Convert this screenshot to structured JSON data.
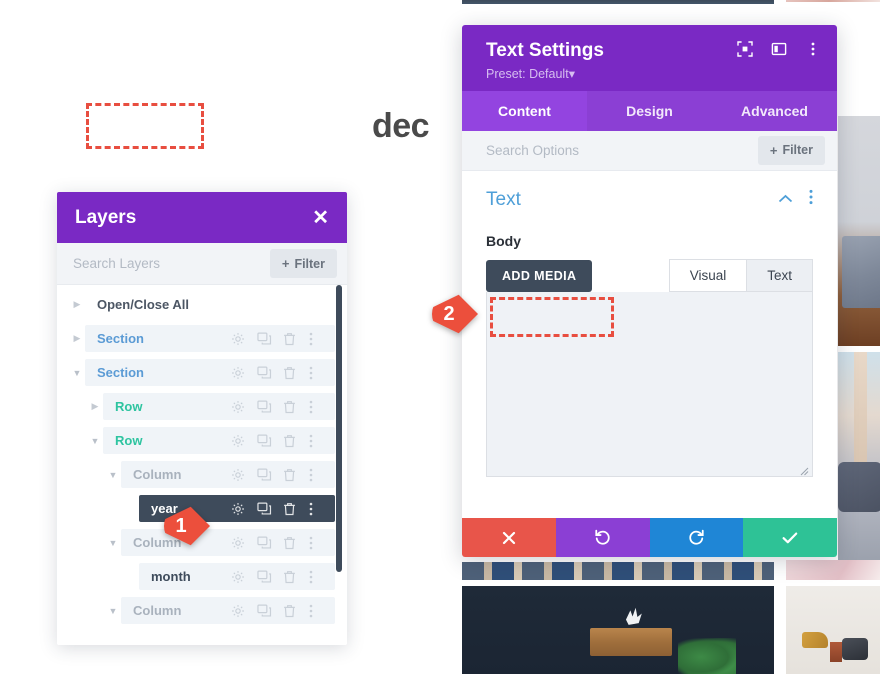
{
  "canvas": {
    "word": "dec",
    "placeholder_name": "empty-text-module"
  },
  "layers_panel": {
    "title": "Layers",
    "close_label": "✕",
    "search_placeholder": "Search Layers",
    "filter_label": "Filter",
    "filter_plus": "+",
    "rows": [
      {
        "label": "Open/Close All",
        "type": "open-close-all",
        "indent": 0,
        "triangle": "right",
        "chip": false,
        "icons": false,
        "active": false
      },
      {
        "label": "Section",
        "type": "section",
        "indent": 0,
        "triangle": "right",
        "chip": true,
        "icons": true,
        "active": false
      },
      {
        "label": "Section",
        "type": "section",
        "indent": 0,
        "triangle": "down",
        "chip": true,
        "icons": true,
        "active": false
      },
      {
        "label": "Row",
        "type": "row",
        "indent": 1,
        "triangle": "right",
        "chip": true,
        "icons": true,
        "active": false
      },
      {
        "label": "Row",
        "type": "row",
        "indent": 1,
        "triangle": "down",
        "chip": true,
        "icons": true,
        "active": false
      },
      {
        "label": "Column",
        "type": "column",
        "indent": 2,
        "triangle": "down",
        "chip": true,
        "icons": true,
        "active": false
      },
      {
        "label": "year",
        "type": "module",
        "indent": 3,
        "triangle": "none",
        "chip": true,
        "icons": true,
        "active": true
      },
      {
        "label": "Column",
        "type": "column",
        "indent": 2,
        "triangle": "down",
        "chip": true,
        "icons": true,
        "active": false
      },
      {
        "label": "month",
        "type": "module",
        "indent": 3,
        "triangle": "none",
        "chip": true,
        "icons": true,
        "active": false
      },
      {
        "label": "Column",
        "type": "column",
        "indent": 2,
        "triangle": "down",
        "chip": true,
        "icons": true,
        "active": false
      }
    ],
    "row_icon_names": [
      "gear-icon",
      "duplicate-icon",
      "trash-icon",
      "more-options-icon"
    ]
  },
  "text_settings": {
    "title": "Text Settings",
    "preset": "Preset: Default",
    "preset_caret": "▾",
    "header_icons": [
      "expand-icon",
      "dock-layout-icon",
      "more-options-icon"
    ],
    "tabs": [
      {
        "label": "Content",
        "active": true
      },
      {
        "label": "Design",
        "active": false
      },
      {
        "label": "Advanced",
        "active": false
      }
    ],
    "search_placeholder": "Search Options",
    "filter_label": "Filter",
    "filter_plus": "+",
    "section": {
      "title": "Text",
      "collapse_icon": "chevron-up-icon",
      "more_icon": "more-options-icon"
    },
    "body_label": "Body",
    "add_media_label": "ADD MEDIA",
    "editor_tabs": [
      {
        "label": "Visual",
        "active": false
      },
      {
        "label": "Text",
        "active": true
      }
    ],
    "editor_value": "",
    "actions": [
      {
        "name": "cancel-button",
        "icon": "close-icon",
        "color": "#e8554a"
      },
      {
        "name": "undo-button",
        "icon": "undo-icon",
        "color": "#8b3fd4"
      },
      {
        "name": "redo-button",
        "icon": "redo-icon",
        "color": "#1f86d6"
      },
      {
        "name": "save-button",
        "icon": "check-icon",
        "color": "#2ec296"
      }
    ]
  },
  "markers": [
    {
      "number": "1",
      "target": "layers-row-gear-icon"
    },
    {
      "number": "2",
      "target": "editor-body-field"
    }
  ],
  "colors": {
    "brand_purple": "#7a29c4",
    "tab_purple": "#8b3fd4",
    "tab_active_purple": "#9344e0",
    "dashed_red": "#e84e40",
    "marker_red": "#ec4f3c",
    "section_blue": "#5b9bd5",
    "row_teal": "#2ec4a0",
    "column_grey": "#a9b2bd",
    "dark_slate": "#3e4b5b"
  }
}
